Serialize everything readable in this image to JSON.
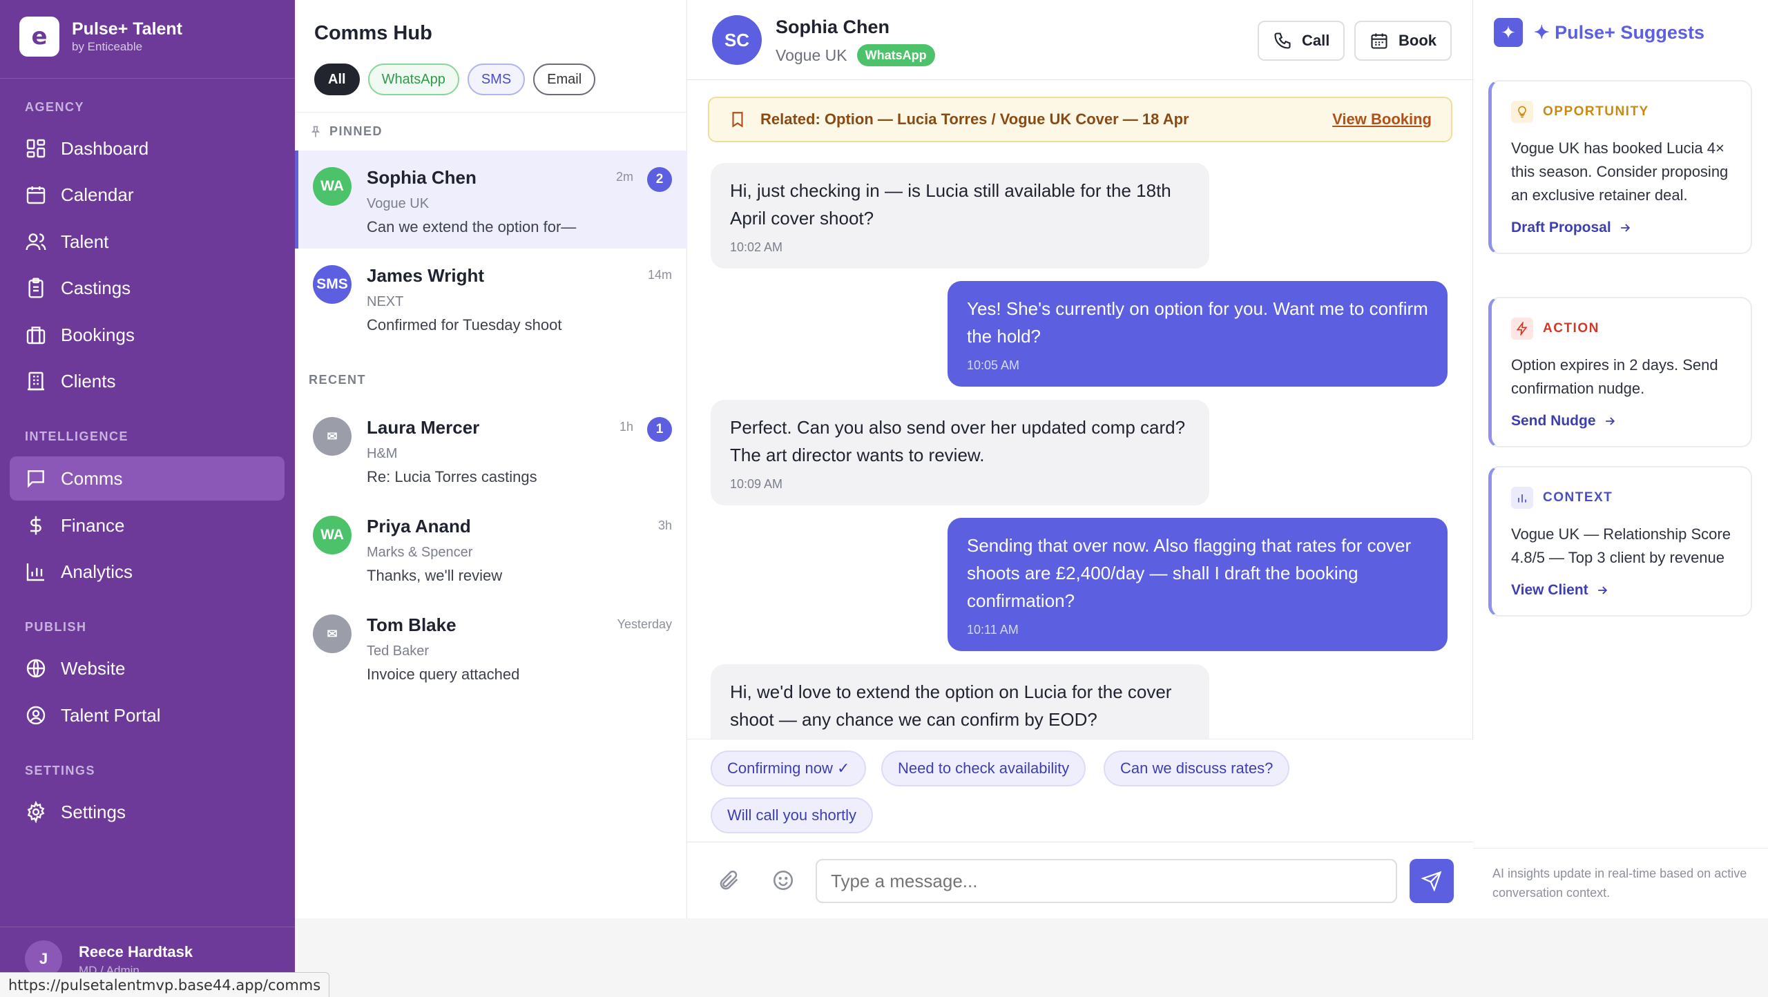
{
  "brand": {
    "logo_letter": "e",
    "name": "Pulse+ Talent",
    "sub": "by Enticeable"
  },
  "sidebar": {
    "sections": {
      "agency": "AGENCY",
      "intelligence": "INTELLIGENCE",
      "publish": "PUBLISH",
      "settings": "SETTINGS"
    },
    "items": [
      {
        "label": "Dashboard",
        "icon": "dashboard-icon"
      },
      {
        "label": "Calendar",
        "icon": "calendar-icon"
      },
      {
        "label": "Talent",
        "icon": "users-icon"
      },
      {
        "label": "Castings",
        "icon": "clipboard-icon"
      },
      {
        "label": "Bookings",
        "icon": "briefcase-icon"
      },
      {
        "label": "Clients",
        "icon": "building-icon"
      },
      {
        "label": "Comms",
        "icon": "message-icon",
        "active": true
      },
      {
        "label": "Finance",
        "icon": "dollar-icon"
      },
      {
        "label": "Analytics",
        "icon": "bar-chart-icon"
      },
      {
        "label": "Website",
        "icon": "globe-icon"
      },
      {
        "label": "Talent Portal",
        "icon": "user-circle-icon"
      },
      {
        "label": "Settings",
        "icon": "gear-icon"
      }
    ],
    "user": {
      "initial": "J",
      "name": "Reece Hardtask",
      "role": "MD / Admin"
    }
  },
  "status_bar_url": "https://pulsetalentmvp.base44.app/comms",
  "list": {
    "title": "Comms Hub",
    "filters": [
      "All",
      "WhatsApp",
      "SMS",
      "Email"
    ],
    "pinned_label": "PINNED",
    "recent_label": "RECENT",
    "pinned": [
      {
        "avatar": "WA",
        "name": "Sophia Chen",
        "org": "Vogue UK",
        "preview": "Can we extend the option for—",
        "time": "2m",
        "badge": "2"
      },
      {
        "avatar": "SMS",
        "name": "James Wright",
        "org": "NEXT",
        "preview": "Confirmed for Tuesday shoot",
        "time": "14m",
        "badge": ""
      }
    ],
    "recent": [
      {
        "avatar": "✉",
        "name": "Laura Mercer",
        "org": "H&M",
        "preview": "Re: Lucia Torres castings",
        "time": "1h",
        "badge": "1"
      },
      {
        "avatar": "WA",
        "name": "Priya Anand",
        "org": "Marks & Spencer",
        "preview": "Thanks, we'll review",
        "time": "3h",
        "badge": ""
      },
      {
        "avatar": "✉",
        "name": "Tom Blake",
        "org": "Ted Baker",
        "preview": "Invoice query attached",
        "time": "Yesterday",
        "badge": ""
      }
    ]
  },
  "chat": {
    "initials": "SC",
    "name": "Sophia Chen",
    "org": "Vogue UK",
    "channel": "WhatsApp",
    "call_label": "Call",
    "book_label": "Book",
    "related_text": "Related: Option — Lucia Torres / Vogue UK Cover — 18 Apr",
    "related_link": "View Booking",
    "messages": [
      {
        "dir": "in",
        "text": "Hi, just checking in — is Lucia still available for the 18th April cover shoot?",
        "time": "10:02 AM"
      },
      {
        "dir": "out",
        "text": "Yes! She's currently on option for you. Want me to confirm the hold?",
        "time": "10:05 AM"
      },
      {
        "dir": "in",
        "text": "Perfect. Can you also send over her updated comp card? The art director wants to review.",
        "time": "10:09 AM"
      },
      {
        "dir": "out",
        "text": "Sending that over now. Also flagging that rates for cover shoots are £2,400/day — shall I draft the booking confirmation?",
        "time": "10:11 AM"
      },
      {
        "dir": "in",
        "text": "Hi, we'd love to extend the option on Lucia for the cover shoot — any chance we can confirm by EOD?",
        "time": ""
      }
    ],
    "quick_replies": [
      "Confirming now ✓",
      "Need to check availability",
      "Can we discuss rates?",
      "Will call you shortly"
    ],
    "input_placeholder": "Type a message..."
  },
  "suggest": {
    "title": "✦ Pulse+ Suggests",
    "icon": "sparkle-icon",
    "cards": [
      {
        "label": "OPPORTUNITY",
        "color": "#c98a12",
        "icon": "lightbulb-icon",
        "body": "Vogue UK has booked Lucia 4× this season. Consider proposing an exclusive retainer deal.",
        "link": "Draft Proposal"
      },
      {
        "label": "ACTION",
        "color": "#d0382a",
        "icon": "zap-icon",
        "body": "Option expires in 2 days. Send confirmation nudge.",
        "link": "Send Nudge"
      },
      {
        "label": "CONTEXT",
        "color": "#4a4dc8",
        "icon": "chart-icon",
        "body": "Vogue UK — Relationship Score 4.8/5 — Top 3 client by revenue",
        "link": "View Client"
      }
    ],
    "footer": "AI insights update in real-time based on active conversation context."
  }
}
